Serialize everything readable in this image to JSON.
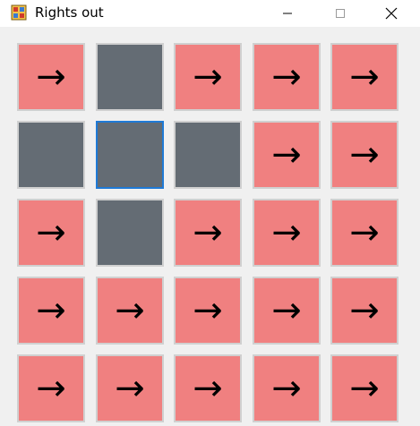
{
  "window": {
    "title": "Rights out"
  },
  "board": {
    "rows": 5,
    "cols": 5,
    "on_color": "#f08080",
    "off_color": "#646c74",
    "focus_color": "#1f7ad6",
    "arrow_glyph": "→",
    "focused_cell": [
      1,
      1
    ],
    "cells": [
      [
        "on",
        "off",
        "on",
        "on",
        "on"
      ],
      [
        "off",
        "off",
        "off",
        "on",
        "on"
      ],
      [
        "on",
        "off",
        "on",
        "on",
        "on"
      ],
      [
        "on",
        "on",
        "on",
        "on",
        "on"
      ],
      [
        "on",
        "on",
        "on",
        "on",
        "on"
      ]
    ]
  }
}
